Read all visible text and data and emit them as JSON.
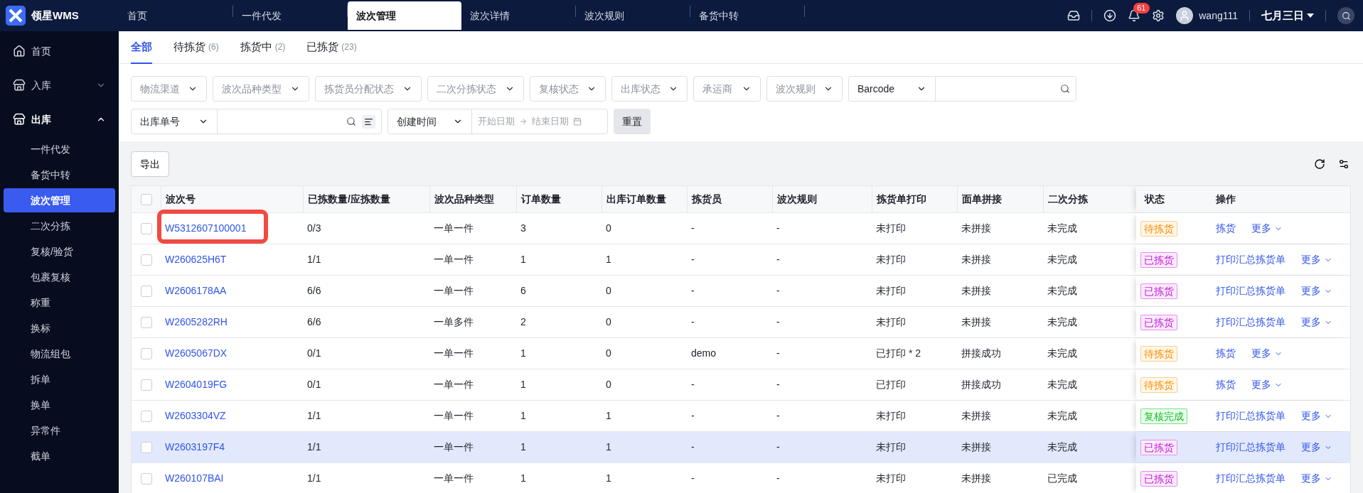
{
  "app": {
    "logo_text": "领星WMS"
  },
  "top_tabs": [
    {
      "label": "首页",
      "selected": false
    },
    {
      "label": "一件代发",
      "selected": false
    },
    {
      "label": "波次管理",
      "selected": true
    },
    {
      "label": "波次详情",
      "selected": false
    },
    {
      "label": "波次规则",
      "selected": false
    },
    {
      "label": "备货中转",
      "selected": false
    }
  ],
  "header": {
    "notification_count": "61",
    "username": "wang111",
    "date": "七月三日"
  },
  "sidebar": {
    "items": [
      {
        "label": "首页",
        "kind": "page"
      },
      {
        "label": "入库",
        "kind": "group",
        "expanded": false
      },
      {
        "label": "出库",
        "kind": "group",
        "expanded": true,
        "children": [
          {
            "label": "一件代发",
            "selected": false
          },
          {
            "label": "备货中转",
            "selected": false
          },
          {
            "label": "波次管理",
            "selected": true
          },
          {
            "label": "二次分拣",
            "selected": false
          },
          {
            "label": "复核/验货",
            "selected": false
          },
          {
            "label": "包裹复核",
            "selected": false
          },
          {
            "label": "称重",
            "selected": false
          },
          {
            "label": "换标",
            "selected": false
          },
          {
            "label": "物流组包",
            "selected": false
          },
          {
            "label": "拆单",
            "selected": false
          },
          {
            "label": "换单",
            "selected": false
          },
          {
            "label": "异常件",
            "selected": false
          },
          {
            "label": "截单",
            "selected": false
          }
        ]
      }
    ]
  },
  "status_tabs": [
    {
      "label": "全部",
      "selected": true
    },
    {
      "label": "待拣货",
      "count": "(6)",
      "selected": false
    },
    {
      "label": "拣货中",
      "count": "(2)",
      "selected": false
    },
    {
      "label": "已拣货",
      "count": "(23)",
      "selected": false
    }
  ],
  "filters": {
    "selects": [
      "物流渠道",
      "波次品种类型",
      "拣货员分配状态",
      "二次分拣状态",
      "复核状态",
      "出库状态",
      "承运商",
      "波次规则"
    ],
    "search_type": "Barcode",
    "order_type": "出库单号",
    "time_type": "创建时间",
    "start_placeholder": "开始日期",
    "end_placeholder": "结束日期",
    "reset": "重置"
  },
  "toolbar": {
    "export": "导出"
  },
  "table": {
    "select_all_checked": false,
    "columns": [
      "波次号",
      "已拣数量/应拣数量",
      "波次品种类型",
      "订单数量",
      "出库订单数量",
      "拣货员",
      "波次规则",
      "拣货单打印",
      "面单拼接",
      "二次分拣",
      "状态",
      "操作"
    ],
    "rows": [
      {
        "checked": false,
        "highlighted": false,
        "cells": [
          "W5312607100001",
          "0/3",
          "一单一件",
          "3",
          "0",
          "-",
          "-",
          "未打印",
          "未拼接",
          "未完成"
        ],
        "status": {
          "label": "待拣货",
          "kind": "pending"
        },
        "actions": [
          "拣货",
          "更多"
        ]
      },
      {
        "checked": false,
        "highlighted": false,
        "cells": [
          "W260625H6T",
          "1/1",
          "一单一件",
          "1",
          "1",
          "-",
          "-",
          "未打印",
          "未拼接",
          "未完成"
        ],
        "status": {
          "label": "已拣货",
          "kind": "picked"
        },
        "actions": [
          "打印汇总拣货单",
          "更多"
        ]
      },
      {
        "checked": false,
        "highlighted": false,
        "cells": [
          "W2606178AA",
          "6/6",
          "一单一件",
          "6",
          "0",
          "-",
          "-",
          "未打印",
          "未拼接",
          "未完成"
        ],
        "status": {
          "label": "已拣货",
          "kind": "picked"
        },
        "actions": [
          "打印汇总拣货单",
          "更多"
        ]
      },
      {
        "checked": false,
        "highlighted": false,
        "cells": [
          "W2605282RH",
          "6/6",
          "一单多件",
          "2",
          "0",
          "-",
          "-",
          "未打印",
          "未拼接",
          "未完成"
        ],
        "status": {
          "label": "已拣货",
          "kind": "picked"
        },
        "actions": [
          "打印汇总拣货单",
          "更多"
        ]
      },
      {
        "checked": false,
        "highlighted": false,
        "cells": [
          "W2605067DX",
          "0/1",
          "一单一件",
          "1",
          "0",
          "demo",
          "-",
          "已打印 * 2",
          "拼接成功",
          "未完成"
        ],
        "status": {
          "label": "待拣货",
          "kind": "pending"
        },
        "actions": [
          "拣货",
          "更多"
        ]
      },
      {
        "checked": false,
        "highlighted": false,
        "cells": [
          "W2604019FG",
          "0/1",
          "一单一件",
          "1",
          "0",
          "-",
          "-",
          "已打印",
          "拼接成功",
          "未完成"
        ],
        "status": {
          "label": "待拣货",
          "kind": "pending"
        },
        "actions": [
          "拣货",
          "更多"
        ]
      },
      {
        "checked": false,
        "highlighted": false,
        "cells": [
          "W2603304VZ",
          "1/1",
          "一单一件",
          "1",
          "1",
          "-",
          "-",
          "未打印",
          "未拼接",
          "未完成"
        ],
        "status": {
          "label": "复核完成",
          "kind": "reviewed"
        },
        "actions": [
          "打印汇总拣货单",
          "更多"
        ]
      },
      {
        "checked": false,
        "highlighted": true,
        "cells": [
          "W2603197F4",
          "1/1",
          "一单一件",
          "1",
          "1",
          "-",
          "-",
          "未打印",
          "未拼接",
          "未完成"
        ],
        "status": {
          "label": "已拣货",
          "kind": "picked"
        },
        "actions": [
          "打印汇总拣货单",
          "更多"
        ]
      },
      {
        "checked": false,
        "highlighted": false,
        "cells": [
          "W260107BAI",
          "1/1",
          "一单一件",
          "1",
          "1",
          "-",
          "-",
          "未打印",
          "未拼接",
          "已完成"
        ],
        "status": {
          "label": "已拣货",
          "kind": "picked"
        },
        "actions": [
          "打印汇总拣货单",
          "更多"
        ]
      }
    ]
  }
}
